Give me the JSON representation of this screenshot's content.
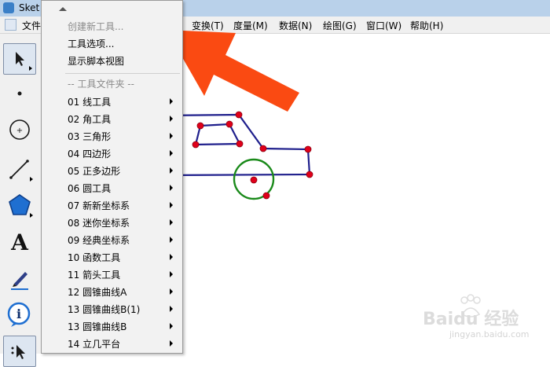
{
  "window": {
    "title": "Sket"
  },
  "menubar": {
    "items": [
      "文件",
      "变换(T)",
      "度量(M)",
      "数据(N)",
      "绘图(G)",
      "窗口(W)",
      "帮助(H)"
    ]
  },
  "toolbox": {
    "tools": [
      "select-arrow",
      "point",
      "compass",
      "straightedge",
      "polygon",
      "text",
      "marker",
      "information",
      "custom"
    ],
    "text_tool_label": "A"
  },
  "dropdown": {
    "top_items": [
      {
        "label": "创建新工具...",
        "enabled": false
      },
      {
        "label": "工具选项...",
        "enabled": true
      },
      {
        "label": "显示脚本视图",
        "enabled": true
      }
    ],
    "section_header": "-- 工具文件夹 --",
    "folders": [
      "01 线工具",
      "02 角工具",
      "03 三角形",
      "04 四边形",
      "05 正多边形",
      "06 圆工具",
      "07 新新坐标系",
      "08 迷你坐标系",
      "09 经典坐标系",
      "10 函数工具",
      "11 箭头工具",
      "12 圆锥曲线A",
      "13 圆锥曲线B(1)",
      "13 圆锥曲线B",
      "14 立几平台"
    ]
  },
  "colors": {
    "shape_stroke": "#1f1f8c",
    "point_fill": "#e0001a",
    "circle_stroke": "#1a8a1a",
    "arrow_fill": "#fa4a12"
  },
  "watermark": {
    "text": "Baidu 经验",
    "url_text": "jingyan.baidu.com"
  }
}
